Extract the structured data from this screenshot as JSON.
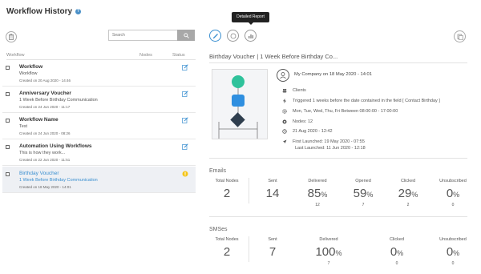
{
  "page": {
    "title": "Workflow History"
  },
  "search": {
    "placeholder": "Search"
  },
  "list": {
    "col_workflow": "Workflow",
    "col_nodes": "Nodes",
    "col_status": "Status",
    "items": [
      {
        "name": "Workflow",
        "desc": "Workflow",
        "created": "Created on 20 Aug 2020 - 14:46",
        "status_icon": "edit-icon"
      },
      {
        "name": "Anniversary Voucher",
        "desc": "1 Week Before Birthday Communication",
        "created": "Created on 24 Jun 2020 - 11:17",
        "status_icon": "edit-icon"
      },
      {
        "name": "Workflow Name",
        "desc": "Test",
        "created": "Created on 24 Jun 2020 - 08:26",
        "status_icon": "edit-icon"
      },
      {
        "name": "Automation Using Workflows",
        "desc": "This is how they work...",
        "created": "Created on 22 Jun 2020 - 11:51",
        "status_icon": "edit-icon"
      },
      {
        "name": "Birthday Voucher",
        "desc": "1 Week Before Birthday Communication",
        "created": "Created on 18 May 2020 - 14:01",
        "status_icon": "warning-icon"
      }
    ]
  },
  "toolbar": {
    "tooltip": "Detailed Report"
  },
  "detail": {
    "title": "Birthday Voucher | 1 Week Before Birthday Co...",
    "owner": "My Company on 18 May 2020 - 14:01",
    "audience": "Clients",
    "trigger": "Triggered 1 weeks before the date contained in the field [ Contact Birthday ]",
    "schedule": "Mon, Tue, Wed, Thu, Fri Between 08:00:00 - 17:00:00",
    "nodes": "Nodes: 12",
    "modified": "21 Aug 2020 - 12:42",
    "first_launched": "First Launched: 19 May 2020 - 07:55",
    "last_launched": "Last Launched: 11 Jun 2020 - 12:18"
  },
  "emails": {
    "title": "Emails",
    "total_nodes_label": "Total Nodes",
    "total_nodes": "2",
    "sent_label": "Sent",
    "sent": "14",
    "delivered_label": "Delivered",
    "delivered": "85",
    "delivered_count": "12",
    "opened_label": "Opened",
    "opened": "59",
    "opened_count": "7",
    "clicked_label": "Clicked",
    "clicked": "29",
    "clicked_count": "2",
    "unsubscribed_label": "Unsubscribed",
    "unsubscribed": "0",
    "unsubscribed_count": "0",
    "pct": "%"
  },
  "smses": {
    "title": "SMSes",
    "total_nodes_label": "Total Nodes",
    "total_nodes": "2",
    "sent_label": "Sent",
    "sent": "7",
    "delivered_label": "Delivered",
    "delivered": "100",
    "delivered_count": "7",
    "clicked_label": "Clicked",
    "clicked": "0",
    "clicked_count": "0",
    "unsubscribed_label": "Unsubscribed",
    "unsubscribed": "0",
    "unsubscribed_count": "0",
    "pct": "%"
  },
  "colors": {
    "accent": "#3a8fd0",
    "start_node": "#2fc29b",
    "action_node": "#2f8fe0",
    "condition_node": "#2f3e4e",
    "warning": "#f5c518"
  }
}
